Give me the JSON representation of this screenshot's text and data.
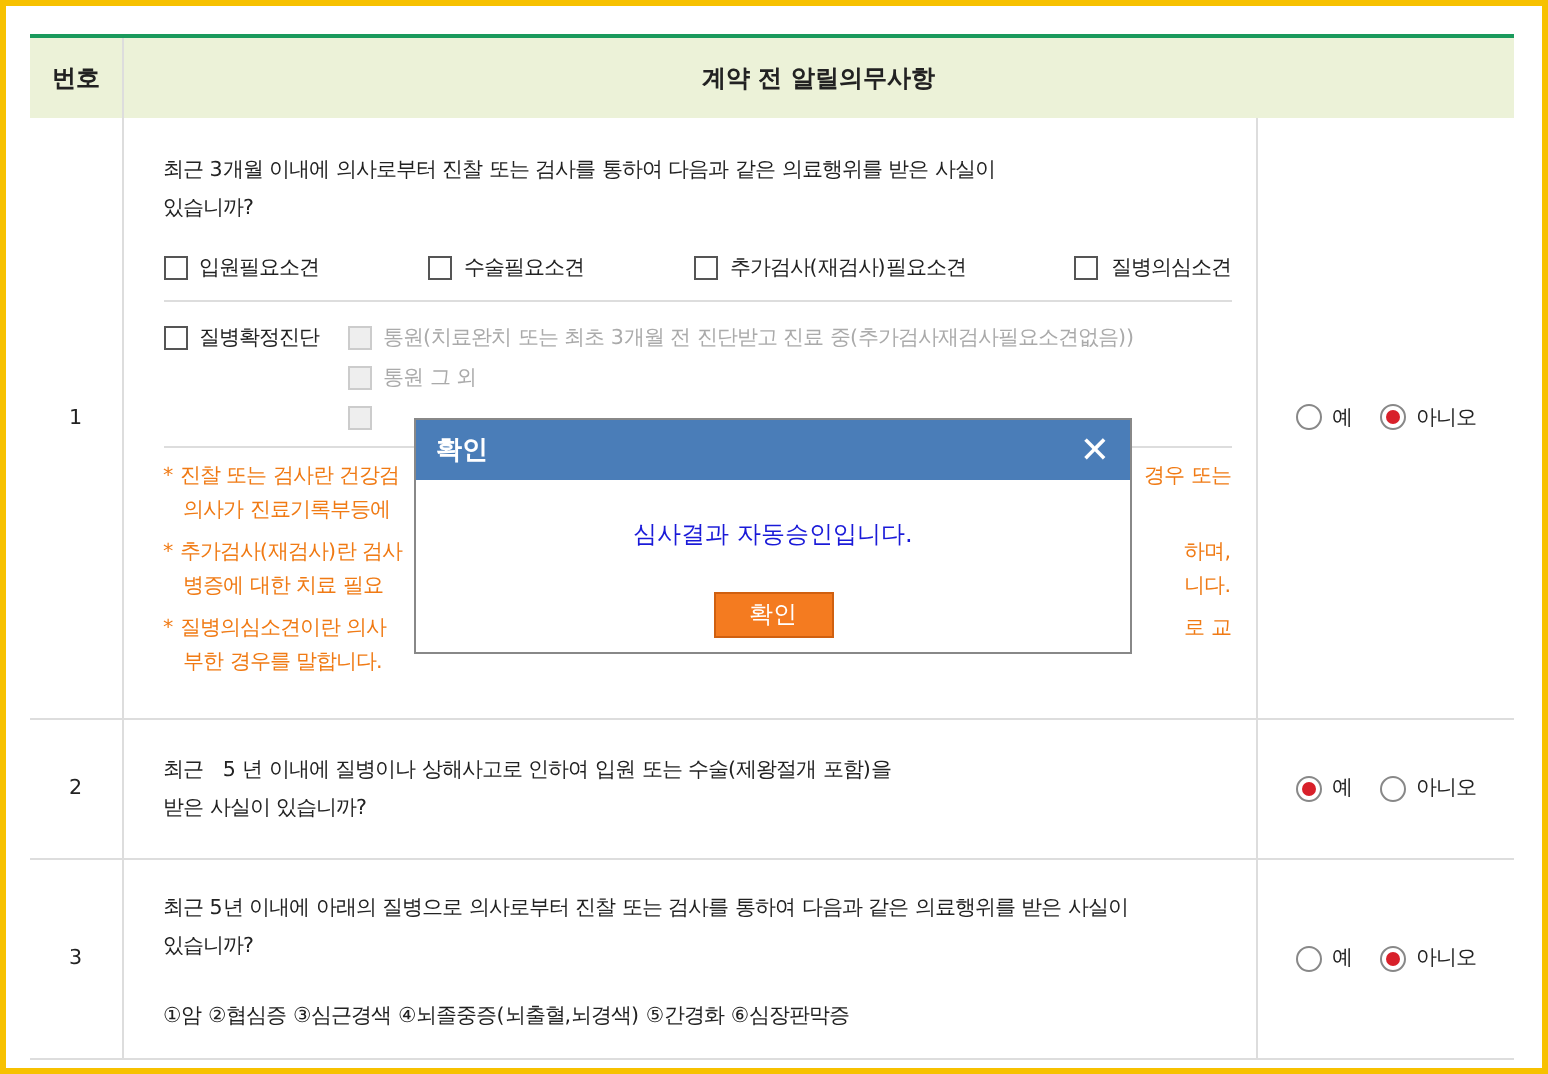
{
  "table": {
    "columns": [
      "번호",
      "계약 전 알릴의무사항"
    ],
    "rows": [
      {
        "number": "1",
        "question": [
          "최근 3개월 이내에 의사로부터 진찰 또는 검사를 통하여 다음과 같은 의료행위를 받은 사실이",
          "있습니까?"
        ],
        "checkboxes": [
          {
            "label": "입원필요소견",
            "checked": false
          },
          {
            "label": "수술필요소견",
            "checked": false
          },
          {
            "label": "추가검사(재검사)필요소견",
            "checked": false
          },
          {
            "label": "질병의심소견",
            "checked": false
          }
        ],
        "diagnosis": {
          "label": "질병확정진단",
          "checked": false,
          "options": [
            {
              "label": "통원(치료완치 또는 최초 3개월 전 진단받고 진료 중(추가검사재검사필요소견없음))",
              "disabled": true
            },
            {
              "label": "통원 그 외",
              "disabled": true
            },
            {
              "disabled": true
            }
          ]
        },
        "notes": [
          [
            {
              "left": "* 진찰 또는 검사란 건강검",
              "right": "경우 또는"
            },
            {
              "left": "의사가 진료기록부등에"
            }
          ],
          [
            {
              "left": "* 추가검사(재검사)란 검사",
              "right": "하며,"
            },
            {
              "left": "병증에 대한 치료 필요",
              "right": "니다."
            }
          ],
          [
            {
              "left": "* 질병의심소견이란 의사",
              "right": "로 교"
            },
            {
              "left": "부한 경우를 말합니다."
            }
          ]
        ],
        "answers": [
          {
            "label": "예",
            "selected": false
          },
          {
            "label": "아니오",
            "selected": true
          }
        ]
      },
      {
        "number": "2",
        "question": [
          "최근   5 년 이내에 질병이나 상해사고로 인하여 입원 또는 수술(제왕절개 포함)을",
          "받은 사실이 있습니까?"
        ],
        "answers": [
          {
            "label": "예",
            "selected": true
          },
          {
            "label": "아니오",
            "selected": false
          }
        ]
      },
      {
        "number": "3",
        "question": [
          "최근 5년 이내에 아래의 질병으로 의사로부터 진찰 또는 검사를 통하여 다음과 같은 의료행위를 받은 사실이",
          "있습니까?"
        ],
        "diseases": "①암 ②협심증 ③심근경색 ④뇌졸중증(뇌출혈,뇌경색) ⑤간경화 ⑥심장판막증",
        "answers": [
          {
            "label": "예",
            "selected": false
          },
          {
            "label": "아니오",
            "selected": true
          }
        ]
      }
    ]
  },
  "dialog": {
    "title": "확인",
    "close": "✕",
    "message": "심사결과 자동승인입니다.",
    "button": "확인"
  }
}
